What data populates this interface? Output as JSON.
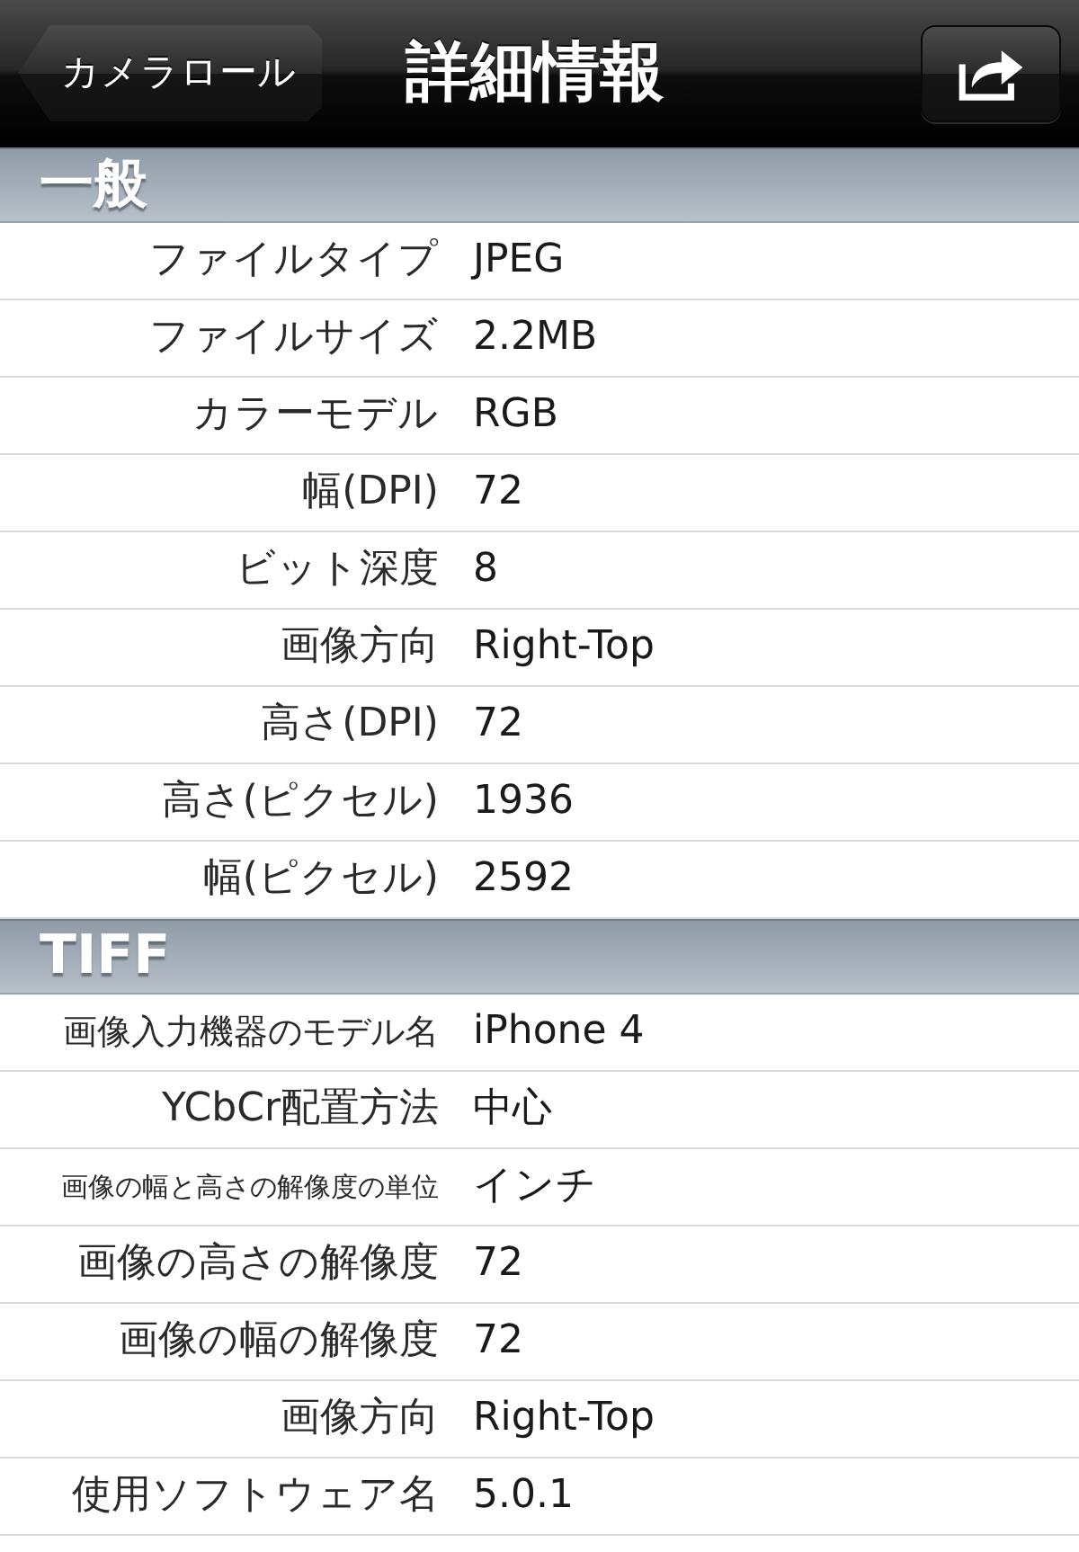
{
  "nav_bar": {
    "back_button": "カメラロール",
    "title": "詳細情報"
  },
  "sections": [
    {
      "title": "一般",
      "rows": [
        {
          "label": "ファイルタイプ",
          "value": "JPEG"
        },
        {
          "label": "ファイルサイズ",
          "value": "2.2MB"
        },
        {
          "label": "カラーモデル",
          "value": "RGB"
        },
        {
          "label": "幅(DPI)",
          "value": "72"
        },
        {
          "label": "ビット深度",
          "value": "8"
        },
        {
          "label": "画像方向",
          "value": "Right-Top"
        },
        {
          "label": "高さ(DPI)",
          "value": "72"
        },
        {
          "label": "高さ(ピクセル)",
          "value": "1936"
        },
        {
          "label": "幅(ピクセル)",
          "value": "2592"
        }
      ]
    },
    {
      "title": "TIFF",
      "rows": [
        {
          "label": "画像入力機器のモデル名",
          "value": "iPhone 4"
        },
        {
          "label": "YCbCr配置方法",
          "value": "中心"
        },
        {
          "label": "画像の幅と高さの解像度の単位",
          "value": "インチ"
        },
        {
          "label": "画像の高さの解像度",
          "value": "72"
        },
        {
          "label": "画像の幅の解像度",
          "value": "72"
        },
        {
          "label": "画像方向",
          "value": "Right-Top"
        },
        {
          "label": "使用ソフトウェア名",
          "value": "5.0.1"
        }
      ]
    }
  ]
}
